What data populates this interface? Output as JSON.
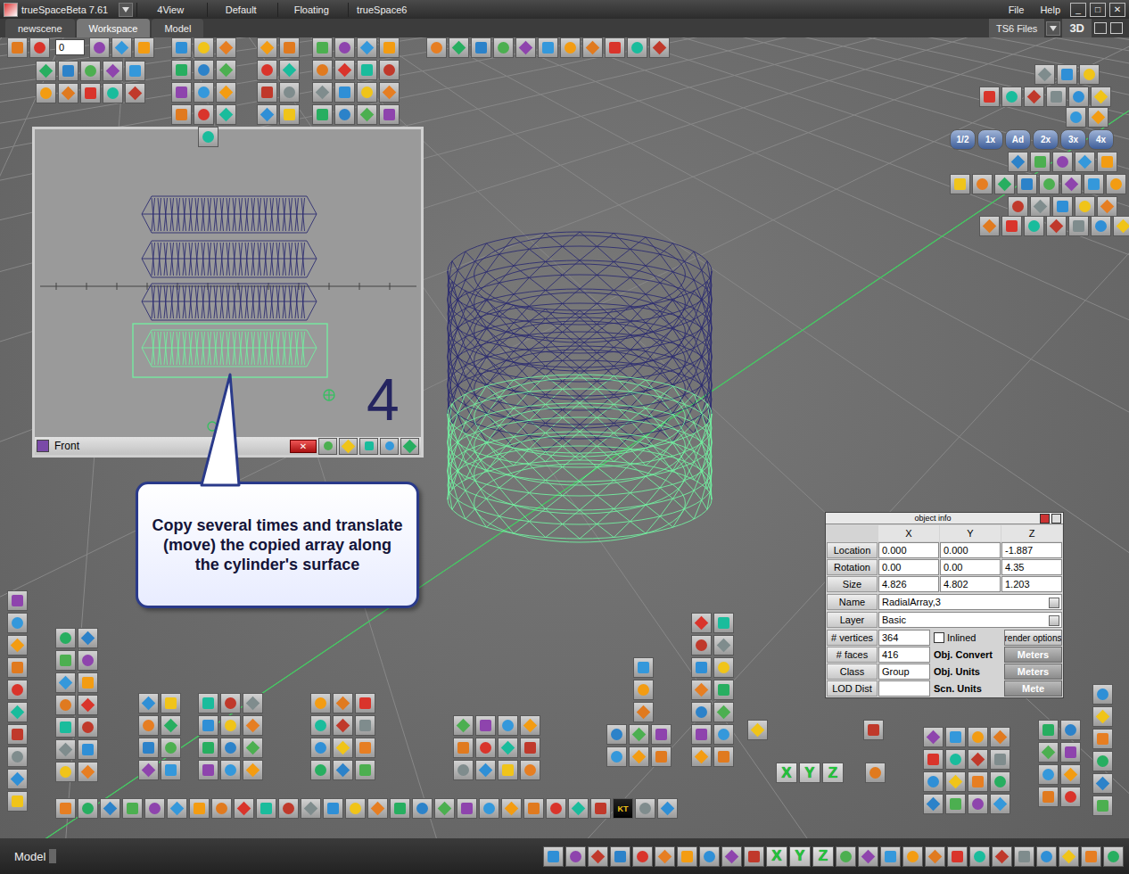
{
  "window": {
    "title": "trueSpaceBeta 7.61",
    "menu": [
      "File",
      "Help"
    ],
    "controls": [
      "_",
      "□",
      "✕"
    ]
  },
  "layout_tabs": [
    {
      "label": "4View",
      "selected": false
    },
    {
      "label": "Default",
      "selected": false
    },
    {
      "label": "Floating",
      "selected": false
    },
    {
      "label": "trueSpace6",
      "selected": false
    }
  ],
  "doc_tabs": [
    {
      "label": "newscene",
      "selected": false
    },
    {
      "label": "Workspace",
      "selected": true
    },
    {
      "label": "Model",
      "selected": false
    }
  ],
  "files_button": "TS6 Files",
  "view_mode": "3D",
  "frame_field": "0",
  "view_toolbar": [
    "1/2",
    "1x",
    "Ad",
    "2x",
    "3x",
    "4x"
  ],
  "front_view": {
    "title": "Front",
    "axis_label": "4",
    "close": "✕"
  },
  "callout": "Copy several times and translate (move) the copied array along the cylinder's surface",
  "object_info": {
    "title": "object info",
    "columns": [
      "X",
      "Y",
      "Z"
    ],
    "rows": [
      {
        "label": "Location",
        "x": "0.000",
        "y": "0.000",
        "z": "-1.887"
      },
      {
        "label": "Rotation",
        "x": "0.00",
        "y": "0.00",
        "z": "4.35"
      },
      {
        "label": "Size",
        "x": "4.826",
        "y": "4.802",
        "z": "1.203"
      }
    ],
    "name_label": "Name",
    "name": "RadialArray,3",
    "layer_label": "Layer",
    "layer": "Basic",
    "stats": [
      {
        "label": "# vertices",
        "value": "364"
      },
      {
        "label": "# faces",
        "value": "416"
      },
      {
        "label": "Class",
        "value": "Group"
      },
      {
        "label": "LOD Dist",
        "value": ""
      }
    ],
    "inlined": {
      "label": "Inlined",
      "checked": false
    },
    "render_options": "render options",
    "units": [
      {
        "label": "Obj. Convert",
        "value": "Meters"
      },
      {
        "label": "Obj. Units",
        "value": "Meters"
      },
      {
        "label": "Scn. Units",
        "value": "Mete"
      }
    ]
  },
  "axis_buttons": [
    "X",
    "Y",
    "Z"
  ],
  "kt_label": "KT",
  "status_bar": {
    "mode": "Model",
    "axis_buttons": [
      "X",
      "Y",
      "Z"
    ]
  }
}
